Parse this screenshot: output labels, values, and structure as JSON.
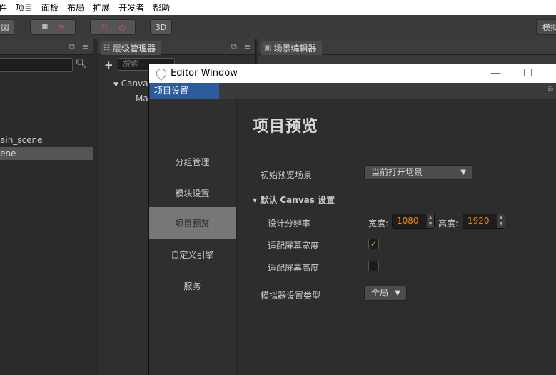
{
  "menubar": {
    "items": [
      "件",
      "项目",
      "面板",
      "布局",
      "扩展",
      "开发者",
      "帮助"
    ]
  },
  "toolbar": {
    "btn1": "図",
    "btn_3d": "3D",
    "right_btn": "模拟"
  },
  "assets": {
    "items": [
      "ain_scene",
      "ene"
    ]
  },
  "hierarchy": {
    "tab": "层级管理器",
    "search_placeholder": "搜索...",
    "rows": [
      "Canva",
      "Ma"
    ]
  },
  "scene": {
    "tab": "场景编辑器"
  },
  "editor_window": {
    "title": "Editor Window",
    "minimize": "—",
    "maximize": "☐",
    "tab": "项目设置",
    "sidebar": [
      "分组管理",
      "模块设置",
      "项目预览",
      "自定义引擎",
      "服务"
    ],
    "active_index": 2,
    "page_title": "项目预览",
    "initial_scene_label": "初始预览场景",
    "initial_scene_value": "当前打开场景",
    "canvas_section": "▾ 默认 Canvas 设置",
    "design_resolution_label": "设计分辨率",
    "width_label": "宽度:",
    "width_value": "1080",
    "height_label": "高度:",
    "height_value": "1920",
    "fit_width_label": "适配屏幕宽度",
    "fit_width_checked": true,
    "fit_height_label": "适配屏幕高度",
    "fit_height_checked": false,
    "simulator_label": "模拟器设置类型",
    "simulator_value": "全局"
  },
  "colors": {
    "accent": "#e08a1c",
    "tab_blue": "#2c5c9e"
  }
}
